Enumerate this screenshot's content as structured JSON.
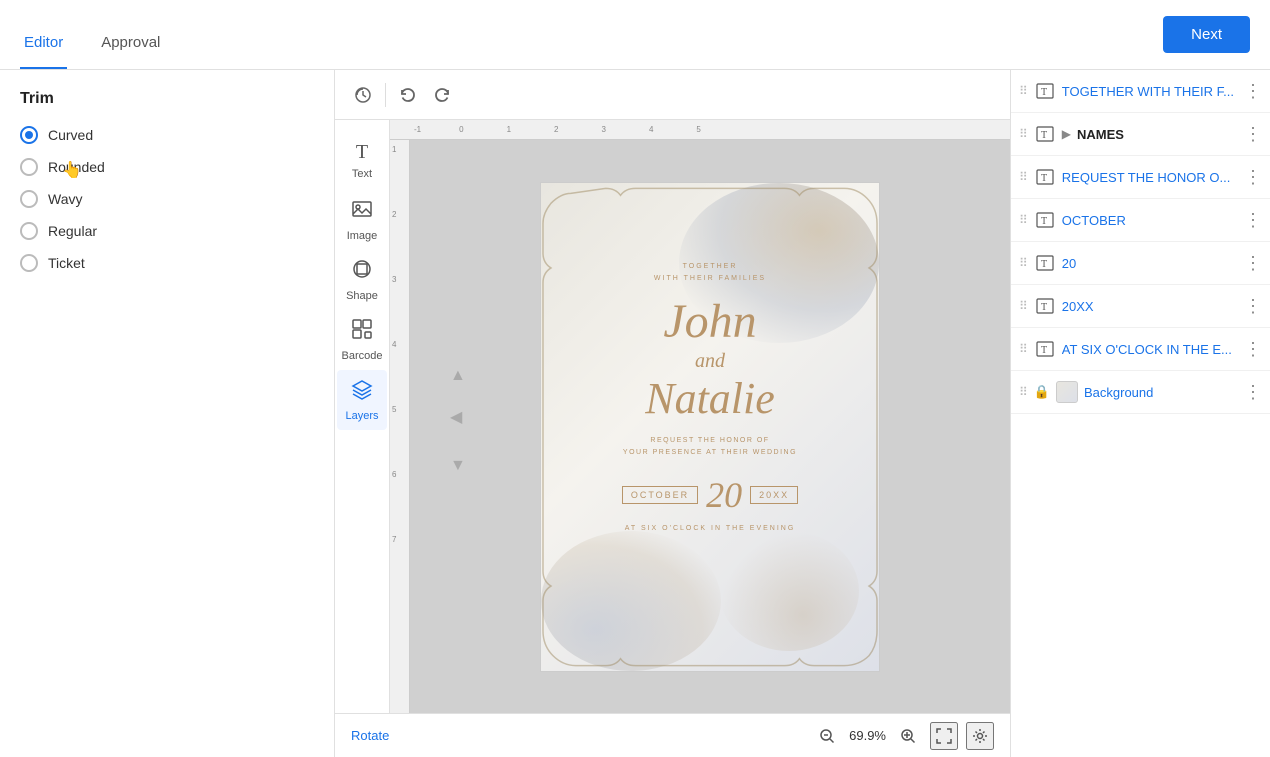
{
  "header": {
    "tab_editor": "Editor",
    "tab_approval": "Approval",
    "next_btn": "Next"
  },
  "trim": {
    "title": "Trim",
    "options": [
      {
        "id": "curved",
        "label": "Curved",
        "selected": true
      },
      {
        "id": "rounded",
        "label": "Rounded",
        "selected": false
      },
      {
        "id": "wavy",
        "label": "Wavy",
        "selected": false
      },
      {
        "id": "regular",
        "label": "Regular",
        "selected": false
      },
      {
        "id": "ticket",
        "label": "Ticket",
        "selected": false
      }
    ]
  },
  "sidebar_icons": [
    {
      "id": "text",
      "label": "Text",
      "icon": "T"
    },
    {
      "id": "image",
      "label": "Image",
      "icon": "🖼"
    },
    {
      "id": "shape",
      "label": "Shape",
      "icon": "⬡"
    },
    {
      "id": "barcode",
      "label": "Barcode",
      "icon": "▦"
    },
    {
      "id": "layers",
      "label": "Layers",
      "icon": "≡",
      "active": true
    }
  ],
  "card": {
    "line1": "TOGETHER",
    "line2": "WITH THEIR FAMILIES",
    "name1": "John",
    "connector": "and",
    "name2": "Natalie",
    "request1": "REQUEST THE HONOR OF",
    "request2": "YOUR PRESENCE AT THEIR WEDDING",
    "month": "OCTOBER",
    "day": "20",
    "year": "20XX",
    "time": "AT SIX O'CLOCK IN THE EVENING"
  },
  "layers": [
    {
      "id": "together",
      "name": "TOGETHER WITH THEIR F...",
      "type": "text",
      "expandable": false
    },
    {
      "id": "names",
      "name": "NAMES",
      "type": "group",
      "expandable": true
    },
    {
      "id": "request",
      "name": "REQUEST THE HONOR O...",
      "type": "text",
      "expandable": false
    },
    {
      "id": "october",
      "name": "OCTOBER",
      "type": "text",
      "expandable": false
    },
    {
      "id": "20",
      "name": "20",
      "type": "text",
      "expandable": false
    },
    {
      "id": "20xx",
      "name": "20XX",
      "type": "text",
      "expandable": false
    },
    {
      "id": "atsix",
      "name": "AT SIX O'CLOCK IN THE E...",
      "type": "text",
      "expandable": false
    },
    {
      "id": "background",
      "name": "Background",
      "type": "background",
      "expandable": false,
      "locked": true
    }
  ],
  "bottom_toolbar": {
    "rotate_label": "Rotate",
    "zoom_level": "69.9%"
  },
  "toolbar": {
    "history_icon": "↺",
    "undo_icon": "↩",
    "redo_icon": "↪"
  }
}
